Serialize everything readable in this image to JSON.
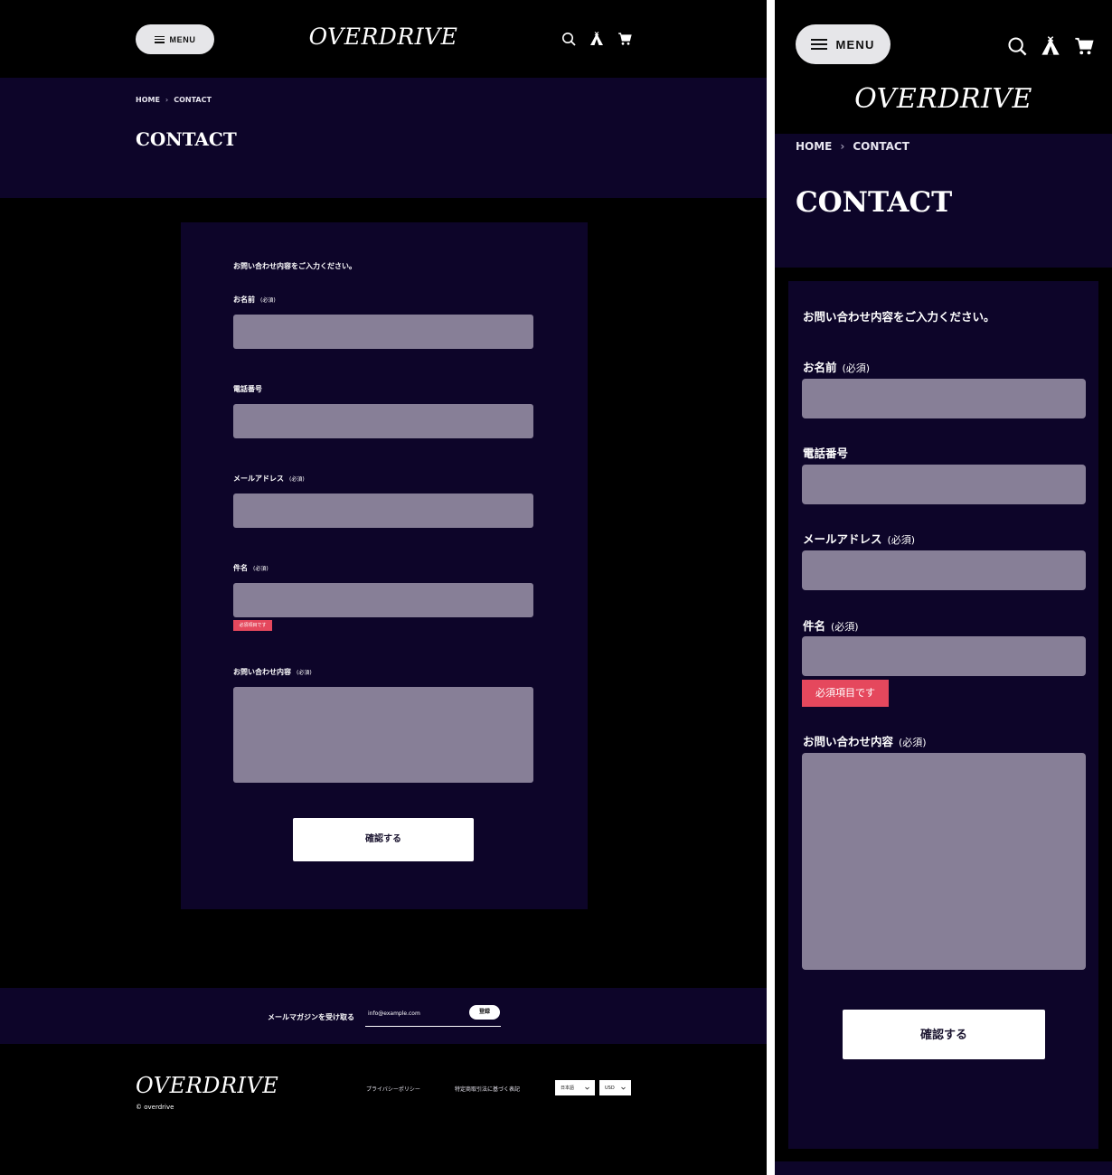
{
  "brand": {
    "logo": "OVERDRIVE",
    "copyright": "© overdrive"
  },
  "header": {
    "menu_label": "MENU"
  },
  "breadcrumb": {
    "home": "HOME",
    "separator": "›",
    "current": "CONTACT"
  },
  "page": {
    "title": "CONTACT"
  },
  "form": {
    "intro": "お問い合わせ内容をご入力ください。",
    "required_mark": "(必須)",
    "fields": {
      "name": "お名前",
      "phone": "電話番号",
      "email": "メールアドレス",
      "subject": "件名",
      "message": "お問い合わせ内容"
    },
    "error_required": "必須項目です",
    "submit_label": "確認する"
  },
  "newsletter": {
    "label": "メールマガジンを受け取る",
    "placeholder": "info@example.com",
    "button": "登録"
  },
  "footer": {
    "links": [
      "プライバシーポリシー",
      "特定商取引法に基づく表記"
    ],
    "language": "日本語",
    "currency": "USD"
  },
  "icons": [
    "menu-icon",
    "search-icon",
    "tent-icon",
    "cart-icon",
    "chevron-right-icon",
    "chevron-down-icon"
  ],
  "colors": {
    "background": "#000000",
    "panel": "#0d0529",
    "field": "#877f97",
    "error": "#e5485d",
    "button": "#ffffff"
  }
}
